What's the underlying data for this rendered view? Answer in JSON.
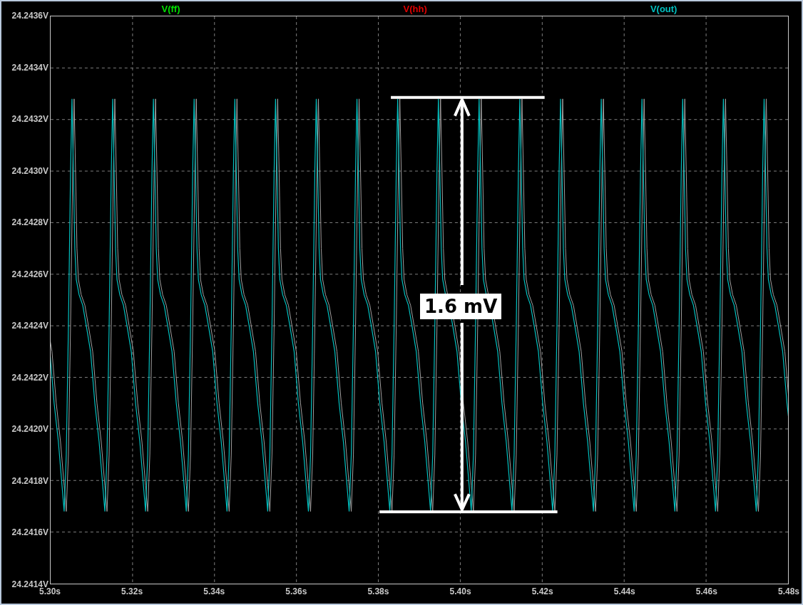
{
  "legend": [
    {
      "label": "V(ff)",
      "color": "#00e000"
    },
    {
      "label": "V(hh)",
      "color": "#e00000"
    },
    {
      "label": "V(out)",
      "color": "#00c0c0"
    }
  ],
  "y_axis": {
    "ticks": [
      "24.2436V",
      "24.2434V",
      "24.2432V",
      "24.2430V",
      "24.2428V",
      "24.2426V",
      "24.2424V",
      "24.2422V",
      "24.2420V",
      "24.2418V",
      "24.2416V",
      "24.2414V"
    ]
  },
  "x_axis": {
    "ticks": [
      "5.30s",
      "5.32s",
      "5.34s",
      "5.36s",
      "5.38s",
      "5.40s",
      "5.42s",
      "5.44s",
      "5.46s",
      "5.48s"
    ]
  },
  "measurement": {
    "label": "1.6 mV"
  }
}
